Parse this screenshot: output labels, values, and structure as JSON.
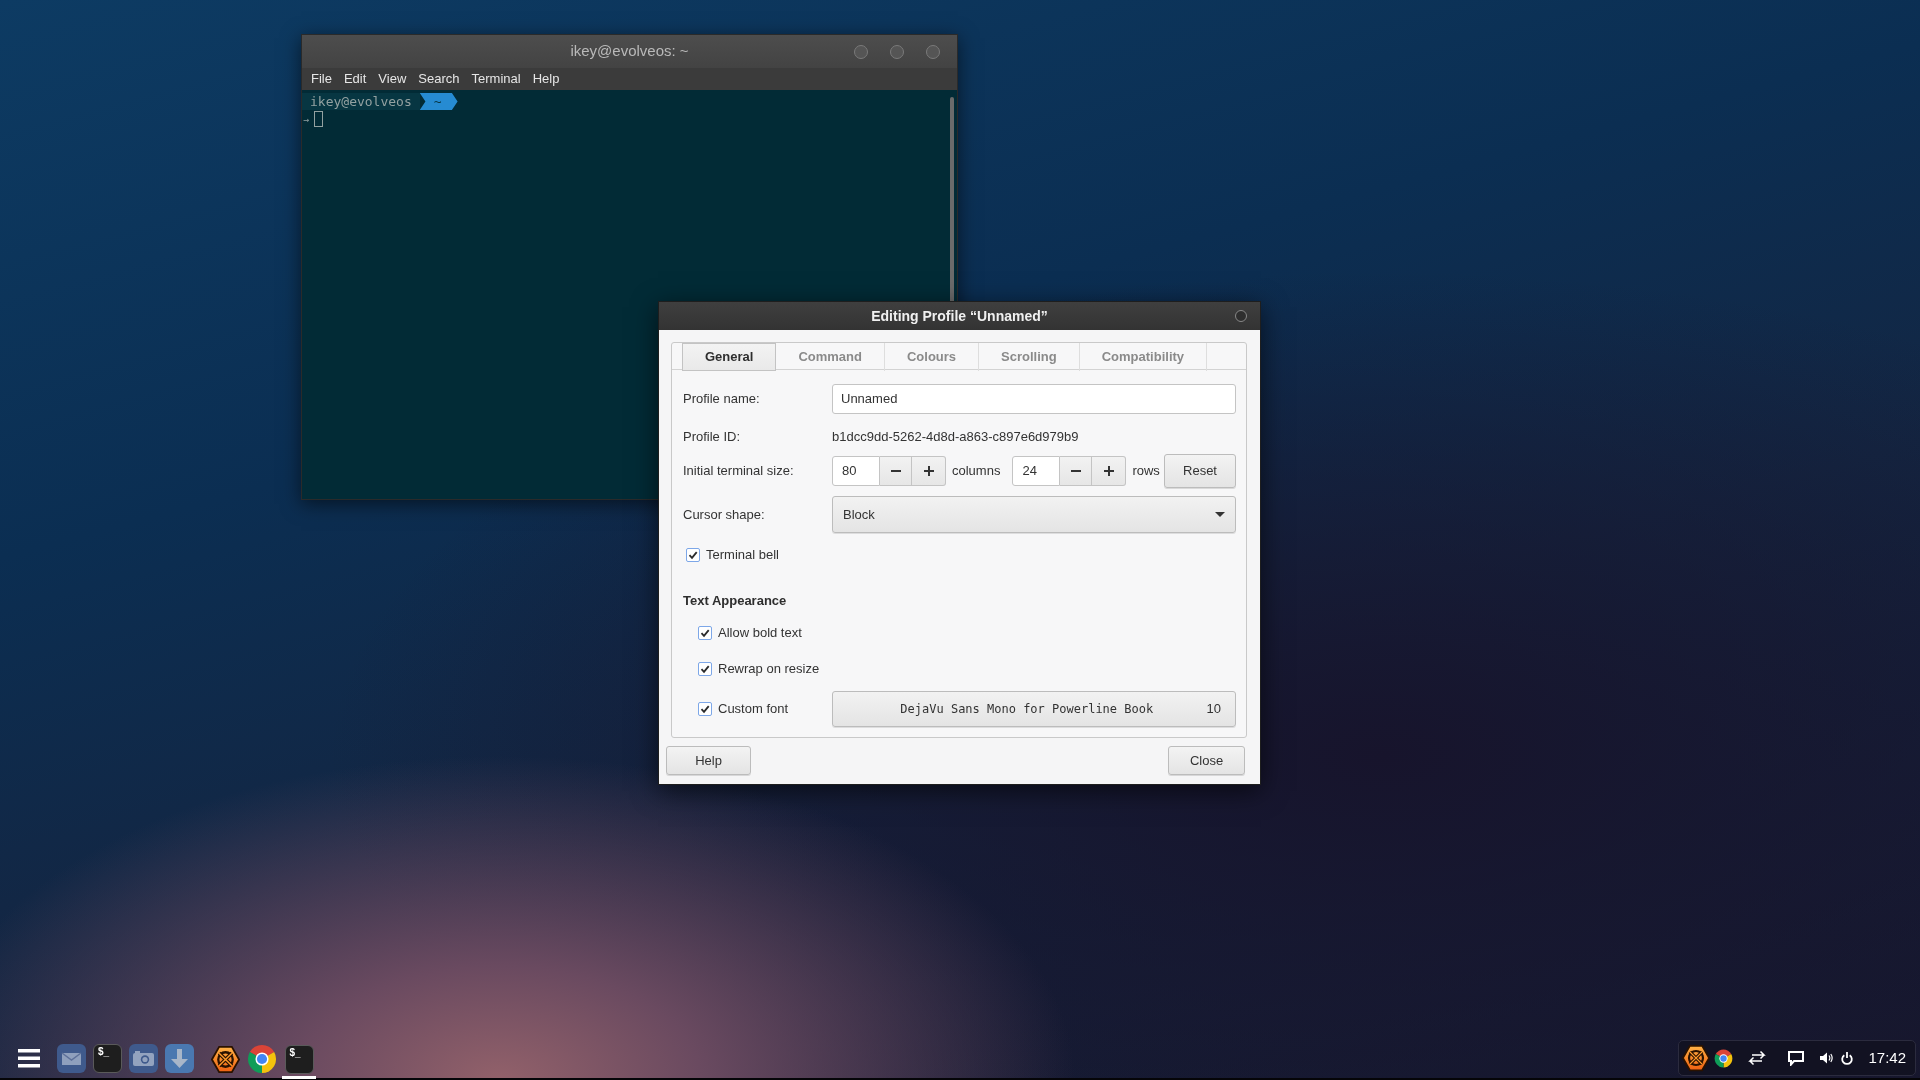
{
  "terminal_window": {
    "title": "ikey@evolveos: ~",
    "menu": [
      "File",
      "Edit",
      "View",
      "Search",
      "Terminal",
      "Help"
    ],
    "prompt": {
      "user_host": "ikey@evolveos",
      "path": "~",
      "arrow": "→"
    }
  },
  "profile_dialog": {
    "title": "Editing Profile “Unnamed”",
    "tabs": [
      {
        "label": "General",
        "selected": true
      },
      {
        "label": "Command",
        "selected": false
      },
      {
        "label": "Colours",
        "selected": false
      },
      {
        "label": "Scrolling",
        "selected": false
      },
      {
        "label": "Compatibility",
        "selected": false
      }
    ],
    "profile_name": {
      "label": "Profile name:",
      "value": "Unnamed"
    },
    "profile_id": {
      "label": "Profile ID:",
      "value": "b1dcc9dd-5262-4d8d-a863-c897e6d979b9"
    },
    "terminal_size": {
      "label": "Initial terminal size:",
      "columns": {
        "value": "80",
        "unit": "columns"
      },
      "rows": {
        "value": "24",
        "unit": "rows"
      },
      "reset_button": "Reset"
    },
    "cursor_shape": {
      "label": "Cursor shape:",
      "value": "Block"
    },
    "terminal_bell": {
      "label": "Terminal bell",
      "checked": true
    },
    "text_appearance": {
      "heading": "Text Appearance",
      "options": [
        {
          "label": "Allow bold text",
          "checked": true
        },
        {
          "label": "Rewrap on resize",
          "checked": true
        },
        {
          "label": "Custom font",
          "checked": true
        }
      ],
      "font_button": {
        "font": "DejaVu Sans Mono for Powerline Book",
        "size": "10"
      }
    },
    "buttons": [
      "Help",
      "Close"
    ]
  },
  "taskbar": {
    "launchers": [
      {
        "kind": "mail"
      },
      {
        "kind": "terminal",
        "glyph": "$_"
      },
      {
        "kind": "camera"
      },
      {
        "kind": "download"
      }
    ],
    "windows": [
      {
        "kind": "hexagon",
        "active": false
      },
      {
        "kind": "browser",
        "active": false
      },
      {
        "kind": "terminal",
        "glyph": "$_",
        "active": true
      }
    ],
    "tray": {
      "clock": "17:42"
    }
  }
}
